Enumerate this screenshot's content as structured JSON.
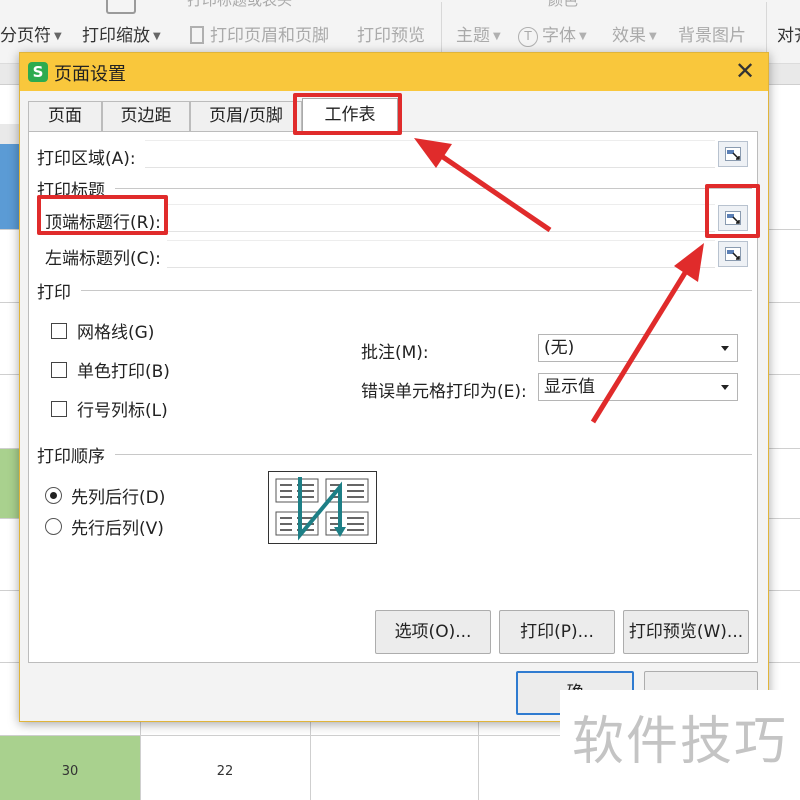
{
  "ribbon": {
    "row_top_labels": [
      "",
      "打印标题或表头",
      "",
      "颜色",
      ""
    ],
    "items": [
      {
        "label": "分页符",
        "has_caret": true
      },
      {
        "label": "打印缩放",
        "has_caret": true
      },
      {
        "label": "打印页眉和页脚"
      },
      {
        "label": "打印预览"
      },
      {
        "label": "主题",
        "has_caret": true
      },
      {
        "label": "字体",
        "has_caret": true
      },
      {
        "label": "效果",
        "has_caret": true
      },
      {
        "label": "背景图片"
      },
      {
        "label": "对齐"
      }
    ]
  },
  "sheet": {
    "cells": [
      "30",
      "22"
    ],
    "colors": {
      "green": "#a9d18e",
      "blue": "#5b9bd5"
    }
  },
  "dialog": {
    "icon_letter": "S",
    "title": "页面设置",
    "tabs": [
      {
        "label": "页面",
        "active": false
      },
      {
        "label": "页边距",
        "active": false
      },
      {
        "label": "页眉/页脚",
        "active": false
      },
      {
        "label": "工作表",
        "active": true
      }
    ],
    "print_area": {
      "label": "打印区域(A):",
      "value": ""
    },
    "print_titles": {
      "heading": "打印标题",
      "top_rows": {
        "label": "顶端标题行(R):",
        "value": ""
      },
      "left_cols": {
        "label": "左端标题列(C):",
        "value": ""
      }
    },
    "print": {
      "heading": "打印",
      "gridlines": {
        "label": "网格线(G)",
        "checked": false
      },
      "mono": {
        "label": "单色打印(B)",
        "checked": false
      },
      "row_col_headers": {
        "label": "行号列标(L)",
        "checked": false
      },
      "comments": {
        "label": "批注(M):",
        "value": "(无)"
      },
      "errors": {
        "label": "错误单元格打印为(E):",
        "value": "显示值"
      }
    },
    "page_order": {
      "heading": "打印顺序",
      "down_then_over": {
        "label": "先列后行(D)",
        "selected": true
      },
      "over_then_down": {
        "label": "先行后列(V)",
        "selected": false
      }
    },
    "buttons": {
      "options": "选项(O)...",
      "print": "打印(P)...",
      "preview": "打印预览(W)...",
      "ok": "确"
    }
  },
  "annotation_color": "#e02b2b",
  "watermark": "软件技巧"
}
